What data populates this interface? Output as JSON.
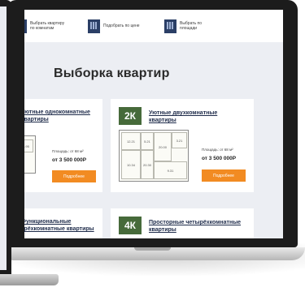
{
  "top_nav": [
    {
      "label": "Выбрать квартиру по комнатам"
    },
    {
      "label": "Подобрать по цене"
    },
    {
      "label": "Выбрать по площади"
    }
  ],
  "headline": "Выборка квартир",
  "cards": [
    {
      "badge": "",
      "title": "Уютные однокомнатные квартиры",
      "area": "Площадь: от 68 м²",
      "price": "от 3 500 000Р",
      "button": "Подробнее"
    },
    {
      "badge": "2К",
      "title": "Уютные двухкомнатные квартиры",
      "area": "Площадь: от 68 м²",
      "price": "от 3 500 000Р",
      "button": "Подробнее"
    },
    {
      "badge": "",
      "title": "Функциональные трёхкомнатные квартиры",
      "area": "",
      "price": "",
      "button": ""
    },
    {
      "badge": "4К",
      "title": "Просторные четырёхкомнатные квартиры",
      "area": "",
      "price": "",
      "button": ""
    }
  ],
  "plan_labels": [
    "12.21",
    "5.21",
    "20.30",
    "10.34",
    "20.00",
    "3.21",
    "9.31"
  ],
  "colors": {
    "accent": "#f28b22",
    "badge": "#466a3a",
    "nav_icon": "#2b3f66"
  }
}
